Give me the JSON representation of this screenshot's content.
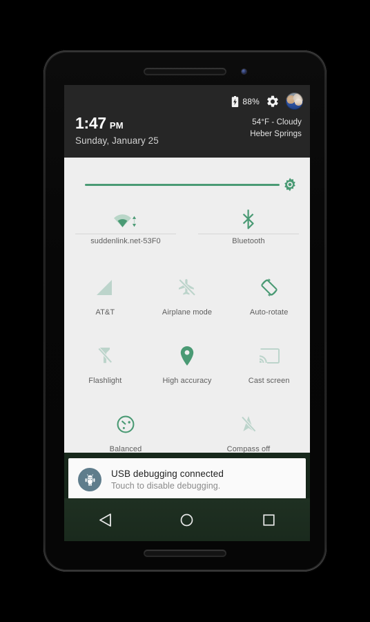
{
  "device": {
    "earpiece_name": "earpiece-speaker",
    "camera_name": "front-camera"
  },
  "status_bar": {
    "battery_percent": "88%",
    "battery_icon": "battery-charging-icon",
    "settings_icon": "gear-icon",
    "avatar": "user-avatar"
  },
  "header": {
    "time": "1:47",
    "ampm": "PM",
    "date": "Sunday, January 25",
    "weather_condition": "54°F - Cloudy",
    "weather_location": "Heber Springs"
  },
  "brightness": {
    "label": "brightness-slider",
    "value_percent": 93,
    "thumb_icon": "brightness-sun-icon"
  },
  "tiles": {
    "row1": [
      {
        "label": "suddenlink.net-53F0",
        "icon": "wifi-icon",
        "state": "on"
      },
      {
        "label": "Bluetooth",
        "icon": "bluetooth-icon",
        "state": "on"
      }
    ],
    "row2": [
      {
        "label": "AT&T",
        "icon": "cellular-signal-icon",
        "state": "off"
      },
      {
        "label": "Airplane mode",
        "icon": "airplane-off-icon",
        "state": "off"
      },
      {
        "label": "Auto-rotate",
        "icon": "auto-rotate-icon",
        "state": "on"
      }
    ],
    "row3": [
      {
        "label": "Flashlight",
        "icon": "flashlight-off-icon",
        "state": "off"
      },
      {
        "label": "High accuracy",
        "icon": "location-pin-icon",
        "state": "on"
      },
      {
        "label": "Cast screen",
        "icon": "cast-screen-icon",
        "state": "off"
      }
    ],
    "row4": [
      {
        "label": "Balanced",
        "icon": "balanced-performance-icon",
        "state": "on"
      },
      {
        "label": "Compass off",
        "icon": "compass-off-icon",
        "state": "off"
      }
    ]
  },
  "notifications": [
    {
      "title": "USB debugging connected",
      "subtitle": "Touch to disable debugging.",
      "icon": "android-bug-icon"
    }
  ],
  "navbar": {
    "back": "back-button",
    "home": "home-button",
    "recents": "recents-button"
  },
  "colors": {
    "accent_on": "#4a9a74",
    "accent_off": "#bcd4cb",
    "panel_bg": "#eeeeee",
    "header_bg": "#262626",
    "wallpaper": "#1d3020"
  }
}
